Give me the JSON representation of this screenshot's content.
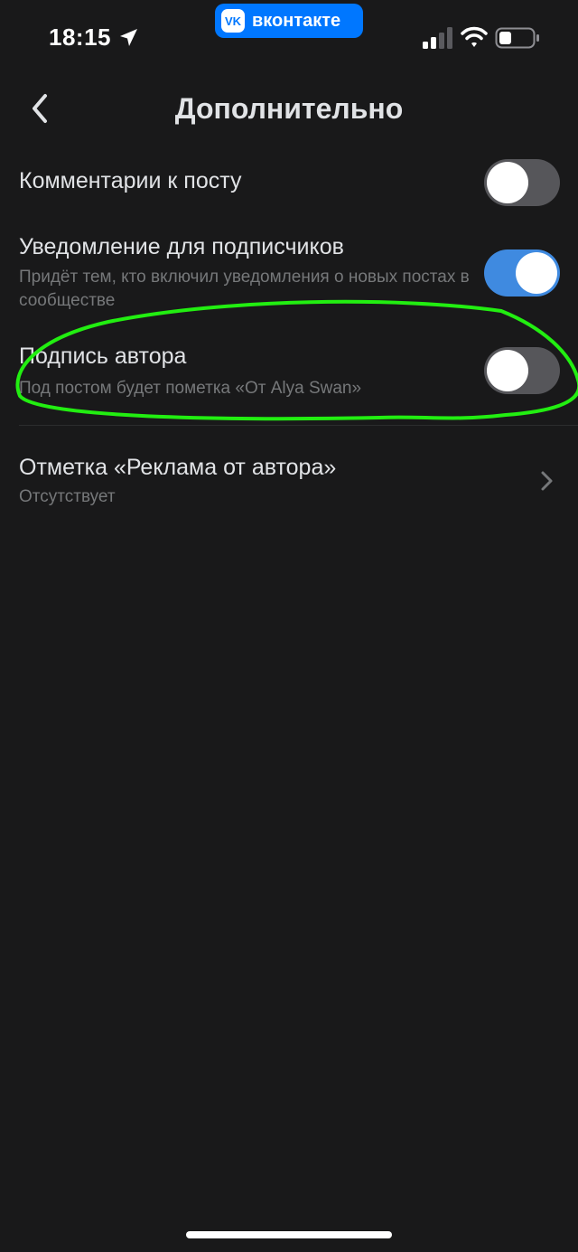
{
  "status_bar": {
    "time": "18:15",
    "icons": [
      "location-arrow-icon",
      "cellular-signal-icon",
      "wifi-icon",
      "battery-icon"
    ]
  },
  "app_badge": {
    "logo": "VK",
    "label": "вконтакте",
    "color": "#0077ff"
  },
  "header": {
    "title": "Дополнительно",
    "back_icon": "chevron-left-icon"
  },
  "settings": [
    {
      "title": "Комментарии к посту",
      "enabled": false
    },
    {
      "title": "Уведомление для подписчиков",
      "subtitle": "Придёт тем, кто включил уведомления о новых постах в сообществе",
      "enabled": true
    },
    {
      "title": "Подпись автора",
      "subtitle": "Под постом будет пометка «От Alya Swan»",
      "enabled": false
    }
  ],
  "ad_mark": {
    "title": "Отметка «Реклама от автора»",
    "value": "Отсутствует",
    "icon": "chevron-right-icon"
  },
  "colors": {
    "background": "#19191a",
    "toggle_on": "#3f8ae0",
    "toggle_off": "#56565a",
    "annotation": "#22ee11"
  }
}
